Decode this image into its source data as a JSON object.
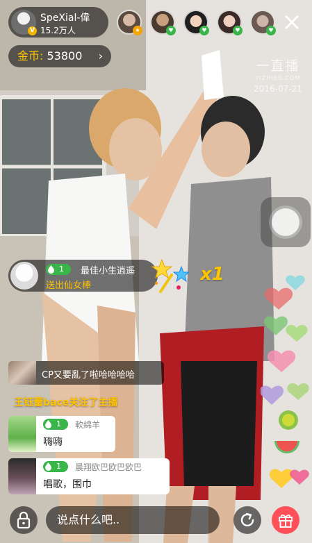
{
  "host": {
    "name": "SpeXial-偉",
    "fans": "15.2万人",
    "badge": "V"
  },
  "viewers": [
    {
      "name": "viewer-1",
      "badge": "gold"
    },
    {
      "name": "viewer-2",
      "badge": "green"
    },
    {
      "name": "viewer-3",
      "badge": "green"
    },
    {
      "name": "viewer-4",
      "badge": "green"
    },
    {
      "name": "viewer-5",
      "badge": "green"
    }
  ],
  "coins": {
    "label": "金币:",
    "value": "53800",
    "chevron": "›"
  },
  "watermark": {
    "logo": "一直播",
    "site": "YIZHIBO.COM",
    "date": "2016-07-21"
  },
  "gift": {
    "level": "1",
    "user": "最佳小生逍遥",
    "action": "送出仙女棒",
    "count": "x1"
  },
  "chat": {
    "compact": "CP又要亂了啦哈哈哈哈",
    "notice": "王钰蕾bace关注了主播",
    "messages": [
      {
        "level": "1",
        "name": "軟綿羊",
        "text": "嗨嗨"
      },
      {
        "level": "1",
        "name": "晨翔欧巴欧巴欧巴",
        "text": "唱歌，围巾"
      }
    ]
  },
  "input": {
    "placeholder": "说点什么吧.."
  },
  "colors": {
    "accent": "#ffc400",
    "level_green": "#3ab54a",
    "gift_red": "#ff4f58"
  }
}
